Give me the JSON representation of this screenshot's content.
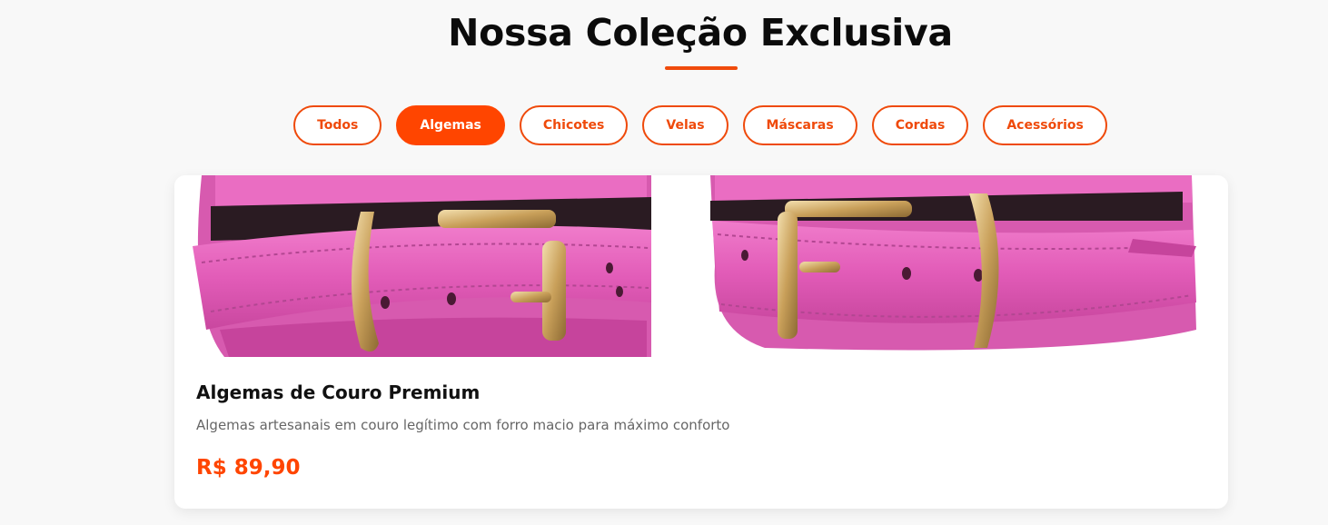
{
  "section": {
    "title": "Nossa Coleção Exclusiva"
  },
  "filters": [
    {
      "label": "Todos",
      "active": false
    },
    {
      "label": "Algemas",
      "active": true
    },
    {
      "label": "Chicotes",
      "active": false
    },
    {
      "label": "Velas",
      "active": false
    },
    {
      "label": "Máscaras",
      "active": false
    },
    {
      "label": "Cordas",
      "active": false
    },
    {
      "label": "Acessórios",
      "active": false
    }
  ],
  "product": {
    "name": "Algemas de Couro Premium",
    "description": "Algemas artesanais em couro legítimo com forro macio para máximo conforto",
    "price": "R$ 89,90",
    "image_subject": "pink leather cuffs with gold buckles"
  },
  "colors": {
    "accent": "#ff4500",
    "accent_border": "#ef4a0b",
    "cuff_pink": "#e45fba",
    "buckle_gold": "#d6b36a"
  }
}
